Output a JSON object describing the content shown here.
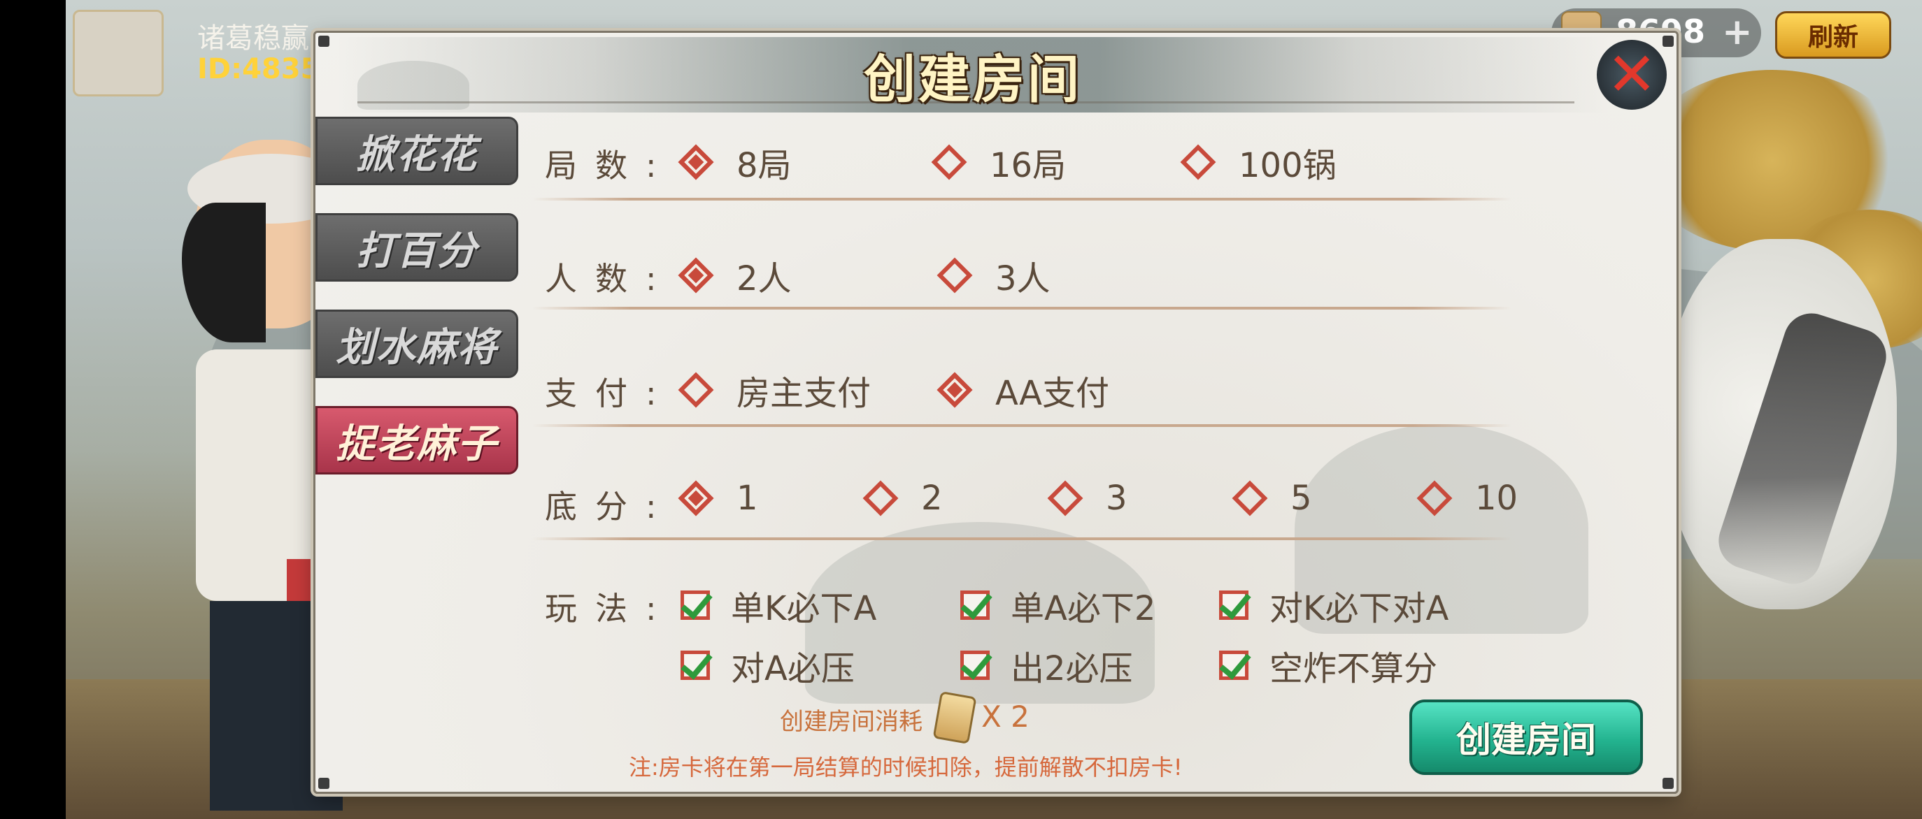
{
  "player": {
    "name": "诸葛稳赢",
    "id": "ID:4835"
  },
  "topbar": {
    "coins": "8698",
    "plus": "+",
    "refresh_label": "刷新"
  },
  "dialog": {
    "title": "创建房间",
    "close_glyph": "✕",
    "tabs": [
      {
        "label": "掀花花",
        "active": false
      },
      {
        "label": "打百分",
        "active": false
      },
      {
        "label": "划水麻将",
        "active": false
      },
      {
        "label": "捉老麻子",
        "active": true
      }
    ],
    "rounds": {
      "label": "局数:",
      "options": [
        {
          "text": "8局",
          "selected": true
        },
        {
          "text": "16局",
          "selected": false
        },
        {
          "text": "100锅",
          "selected": false
        }
      ]
    },
    "players": {
      "label": "人数:",
      "options": [
        {
          "text": "2人",
          "selected": true
        },
        {
          "text": "3人",
          "selected": false
        }
      ]
    },
    "payment": {
      "label": "支付:",
      "options": [
        {
          "text": "房主支付",
          "selected": false
        },
        {
          "text": "AA支付",
          "selected": true
        }
      ]
    },
    "base_score": {
      "label": "底分:",
      "options": [
        {
          "text": "1",
          "selected": true
        },
        {
          "text": "2",
          "selected": false
        },
        {
          "text": "3",
          "selected": false
        },
        {
          "text": "5",
          "selected": false
        },
        {
          "text": "10",
          "selected": false
        }
      ]
    },
    "rules": {
      "label": "玩法:",
      "options": [
        {
          "text": "单K必下A",
          "checked": true
        },
        {
          "text": "单A必下2",
          "checked": true
        },
        {
          "text": "对K必下对A",
          "checked": true
        },
        {
          "text": "对A必压",
          "checked": true
        },
        {
          "text": "出2必压",
          "checked": true
        },
        {
          "text": "空炸不算分",
          "checked": true
        }
      ]
    },
    "cost": {
      "label": "创建房间消耗",
      "value": "X 2"
    },
    "notice": "注:房卡将在第一局结算的时候扣除，提前解散不扣房卡!",
    "create_button": "创建房间"
  },
  "colors": {
    "accent_red": "#c84a3b",
    "create_green": "#23b38f",
    "text_brown": "#5b4a3a",
    "notice_orange": "#d6683c",
    "tab_active": "#a8344a"
  }
}
